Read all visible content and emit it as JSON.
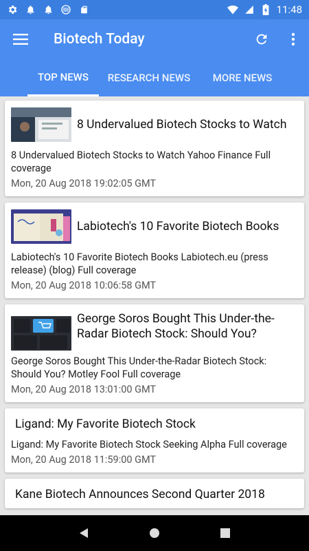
{
  "status_bar": {
    "time": "11:48",
    "icons": [
      "settings-icon",
      "notification-icon",
      "notification-icon",
      "circle-icon",
      "sd-card-icon"
    ]
  },
  "app_bar": {
    "title": "Biotech Today",
    "menu_icon": "hamburger-menu-icon",
    "refresh_icon": "refresh-icon",
    "more_icon": "more-vert-icon"
  },
  "tabs": [
    {
      "label": "TOP NEWS",
      "active": true
    },
    {
      "label": "RESEARCH NEWS",
      "active": false
    },
    {
      "label": "MORE NEWS",
      "active": false
    }
  ],
  "articles": [
    {
      "title": "8 Undervalued Biotech Stocks to Watch",
      "description": "8 Undervalued Biotech Stocks to Watch  Yahoo Finance  Full coverage",
      "date": "Mon, 20 Aug 2018 19:02:05 GMT",
      "has_thumb": true
    },
    {
      "title": "Labiotech's 10 Favorite Biotech Books",
      "description": "Labiotech's 10 Favorite Biotech Books  Labiotech.eu (press release) (blog)  Full coverage",
      "date": "Mon, 20 Aug 2018 10:06:58 GMT",
      "has_thumb": true
    },
    {
      "title": "George Soros Bought This Under-the-Radar Biotech Stock: Should You?",
      "description": "George Soros Bought This Under-the-Radar Biotech Stock: Should You?  Motley Fool  Full coverage",
      "date": "Mon, 20 Aug 2018 13:01:00 GMT",
      "has_thumb": true
    },
    {
      "title": "Ligand: My Favorite Biotech Stock",
      "description": "Ligand: My Favorite Biotech Stock  Seeking Alpha  Full coverage",
      "date": "Mon, 20 Aug 2018 11:59:00 GMT",
      "has_thumb": false
    },
    {
      "title": "Kane Biotech Announces Second Quarter 2018",
      "description": "",
      "date": "",
      "has_thumb": false
    }
  ],
  "colors": {
    "primary": "#4a8cf0",
    "status_bar": "#3a7fe0",
    "background": "#e6e6e6"
  }
}
